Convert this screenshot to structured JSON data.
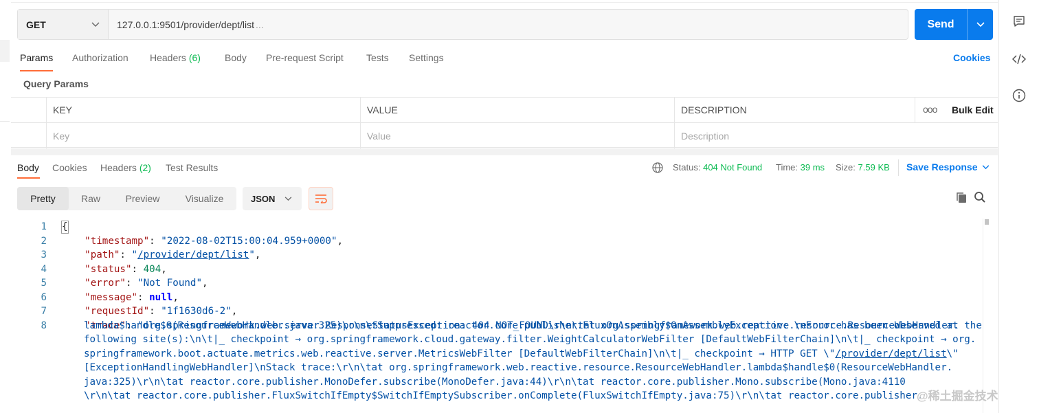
{
  "request": {
    "method": "GET",
    "url": "127.0.0.1:9501/provider/dept/list",
    "url_overflow": "...",
    "send_label": "Send"
  },
  "request_tabs": {
    "params": "Params",
    "authorization": "Authorization",
    "headers": "Headers",
    "headers_count": "(6)",
    "body": "Body",
    "prerequest": "Pre-request Script",
    "tests": "Tests",
    "settings": "Settings",
    "cookies": "Cookies"
  },
  "query_params": {
    "title": "Query Params",
    "columns": [
      "KEY",
      "VALUE",
      "DESCRIPTION"
    ],
    "placeholders": [
      "Key",
      "Value",
      "Description"
    ],
    "more": "ooo",
    "bulk_edit": "Bulk Edit"
  },
  "response_tabs": {
    "body": "Body",
    "cookies": "Cookies",
    "headers": "Headers",
    "headers_count": "(2)",
    "test_results": "Test Results"
  },
  "response_meta": {
    "status_label": "Status:",
    "status_value": "404 Not Found",
    "time_label": "Time:",
    "time_value": "39 ms",
    "size_label": "Size:",
    "size_value": "7.59 KB",
    "save_response": "Save Response"
  },
  "format": {
    "pretty": "Pretty",
    "raw": "Raw",
    "preview": "Preview",
    "visualize": "Visualize",
    "language": "JSON"
  },
  "response_body": {
    "line_numbers": [
      "1",
      "2",
      "3",
      "4",
      "5",
      "6",
      "7",
      "8"
    ],
    "open_brace": "{",
    "timestamp_key": "\"timestamp\"",
    "timestamp_val": "\"2022-08-02T15:00:04.959+0000\"",
    "path_key": "\"path\"",
    "path_q1": "\"",
    "path_val": "/provider/dept/list",
    "path_q2": "\"",
    "status_key": "\"status\"",
    "status_val": "404",
    "error_key": "\"error\"",
    "error_val": "\"Not Found\"",
    "message_key": "\"message\"",
    "message_val": "null",
    "requestId_key": "\"requestId\"",
    "requestId_val": "\"1f1630d6-2\"",
    "trace_key": "\"trace\"",
    "trace_lines": [
      "\"org.springframework.web.server.ResponseStatusException: 404 NOT_FOUND\\r\\n\\tat org.springframework.web.reactive.resource.ResourceWebHandler.",
      "lambda$handle$0(ResourceWebHandler.java:325)\\r\\n\\tSuppressed: reactor.core.publisher.FluxOnAssembly$OnAssemblyException: \\nError has been observed at the",
      "following site(s):\\n\\t|_ checkpoint → org.springframework.cloud.gateway.filter.WeightCalculatorWebFilter [DefaultWebFilterChain]\\n\\t|_ checkpoint → org.",
      "springframework.boot.actuate.metrics.web.reactive.server.MetricsWebFilter [DefaultWebFilterChain]\\n\\t|_ checkpoint → HTTP GET \\\"",
      "[ExceptionHandlingWebHandler]\\nStack trace:\\r\\n\\tat org.springframework.web.reactive.resource.ResourceWebHandler.lambda$handle$0(ResourceWebHandler.",
      "java:325)\\r\\n\\tat reactor.core.publisher.MonoDefer.subscribe(MonoDefer.java:44)\\r\\n\\tat reactor.core.publisher.Mono.subscribe(Mono.java:4110",
      "\\r\\n\\tat reactor.core.publisher.FluxSwitchIfEmpty$SwitchIfEmptySubscriber.onComplete(FluxSwitchIfEmpty.java:75)\\r\\n\\tat reactor.core.publisher."
    ],
    "trace_link": "/provider/dept/list",
    "trace_link_tail": "\\\""
  },
  "watermark": "@稀土掘金技术社区",
  "colors": {
    "accent": "#ff6c37",
    "primary": "#097bed",
    "success": "#0cbb52"
  }
}
